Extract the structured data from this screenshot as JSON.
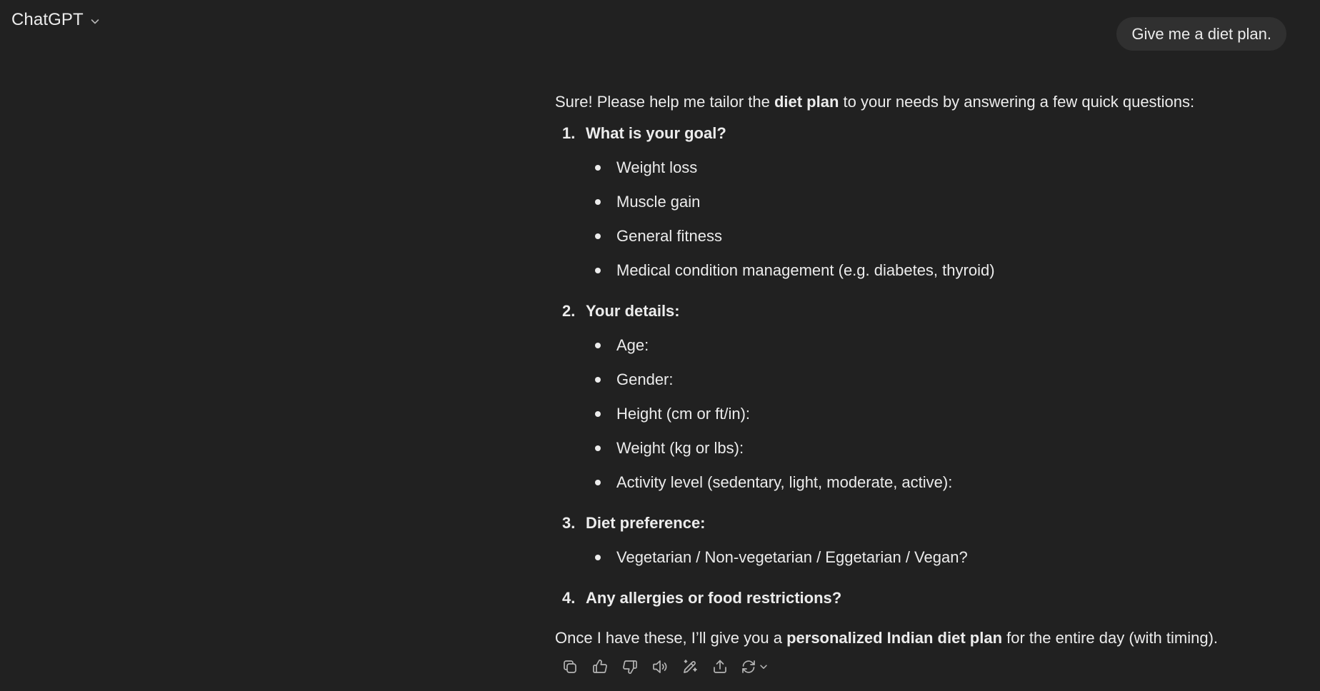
{
  "header": {
    "title": "ChatGPT",
    "model_menu_icon": "chevron-down-icon"
  },
  "user_message": {
    "text": "Give me a diet plan."
  },
  "assistant_message": {
    "intro": {
      "before": "Sure! Please help me tailor the ",
      "bold": "diet plan",
      "after": " to your needs by answering a few quick questions:"
    },
    "questions": [
      {
        "number": "1.",
        "heading": "What is your goal?",
        "bullets": [
          "Weight loss",
          "Muscle gain",
          "General fitness",
          "Medical condition management (e.g. diabetes, thyroid)"
        ]
      },
      {
        "number": "2.",
        "heading": "Your details:",
        "bullets": [
          "Age:",
          "Gender:",
          "Height (cm or ft/in):",
          "Weight (kg or lbs):",
          "Activity level (sedentary, light, moderate, active):"
        ]
      },
      {
        "number": "3.",
        "heading": "Diet preference:",
        "bullets": [
          "Vegetarian / Non-vegetarian / Eggetarian / Vegan?"
        ]
      },
      {
        "number": "4.",
        "heading": "Any allergies or food restrictions?",
        "bullets": []
      }
    ],
    "outro": {
      "before": "Once I have these, I’ll give you a ",
      "bold": "personalized Indian diet plan",
      "after": " for the entire day (with timing)."
    }
  },
  "actions": [
    {
      "icon": "copy-icon",
      "name": "copy-button"
    },
    {
      "icon": "thumbs-up-icon",
      "name": "good-response-button"
    },
    {
      "icon": "thumbs-down-icon",
      "name": "bad-response-button"
    },
    {
      "icon": "speaker-icon",
      "name": "read-aloud-button"
    },
    {
      "icon": "edit-canvas-icon",
      "name": "edit-in-canvas-button"
    },
    {
      "icon": "share-icon",
      "name": "share-button"
    },
    {
      "icon": "regenerate-icon",
      "name": "regenerate-button"
    }
  ],
  "colors": {
    "background": "#212121",
    "bubble": "#303030",
    "text": "#ececec"
  }
}
